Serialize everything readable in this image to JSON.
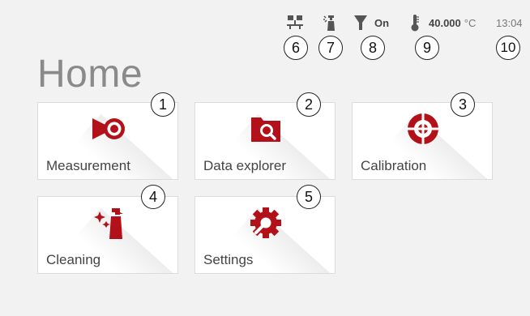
{
  "page": {
    "title": "Home"
  },
  "status": {
    "pump_state": "On",
    "temperature_value": "40.000",
    "temperature_unit": "°C",
    "clock": "13:04"
  },
  "callouts": [
    "1",
    "2",
    "3",
    "4",
    "5",
    "6",
    "7",
    "8",
    "9",
    "10"
  ],
  "tiles": [
    {
      "label": "Measurement",
      "icon": "measurement-icon"
    },
    {
      "label": "Data explorer",
      "icon": "data-explorer-icon"
    },
    {
      "label": "Calibration",
      "icon": "calibration-icon"
    },
    {
      "label": "Cleaning",
      "icon": "cleaning-icon"
    },
    {
      "label": "Settings",
      "icon": "settings-icon"
    }
  ],
  "colors": {
    "accent": "#b3111a",
    "background": "#f2f2f2",
    "tile": "#ffffff"
  }
}
